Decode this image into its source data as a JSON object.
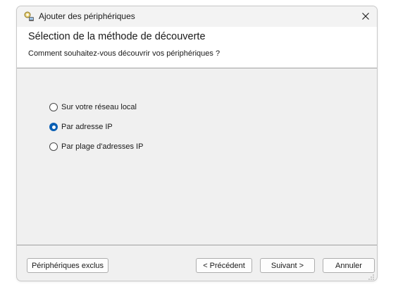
{
  "window": {
    "title": "Ajouter des périphériques",
    "icon": "add-device-icon"
  },
  "header": {
    "title": "Sélection de la méthode de découverte",
    "subtitle": "Comment souhaitez-vous découvrir vos périphériques ?"
  },
  "options": [
    {
      "label": "Sur votre réseau local",
      "checked": false
    },
    {
      "label": "Par adresse IP",
      "checked": true
    },
    {
      "label": "Par plage d'adresses IP",
      "checked": false
    }
  ],
  "buttons": {
    "excluded": "Périphériques exclus",
    "previous": "< Précédent",
    "next": "Suivant >",
    "cancel": "Annuler"
  },
  "colors": {
    "accent": "#0a5fb4",
    "window_bg": "#f0f0f0",
    "header_bg": "#ffffff"
  }
}
